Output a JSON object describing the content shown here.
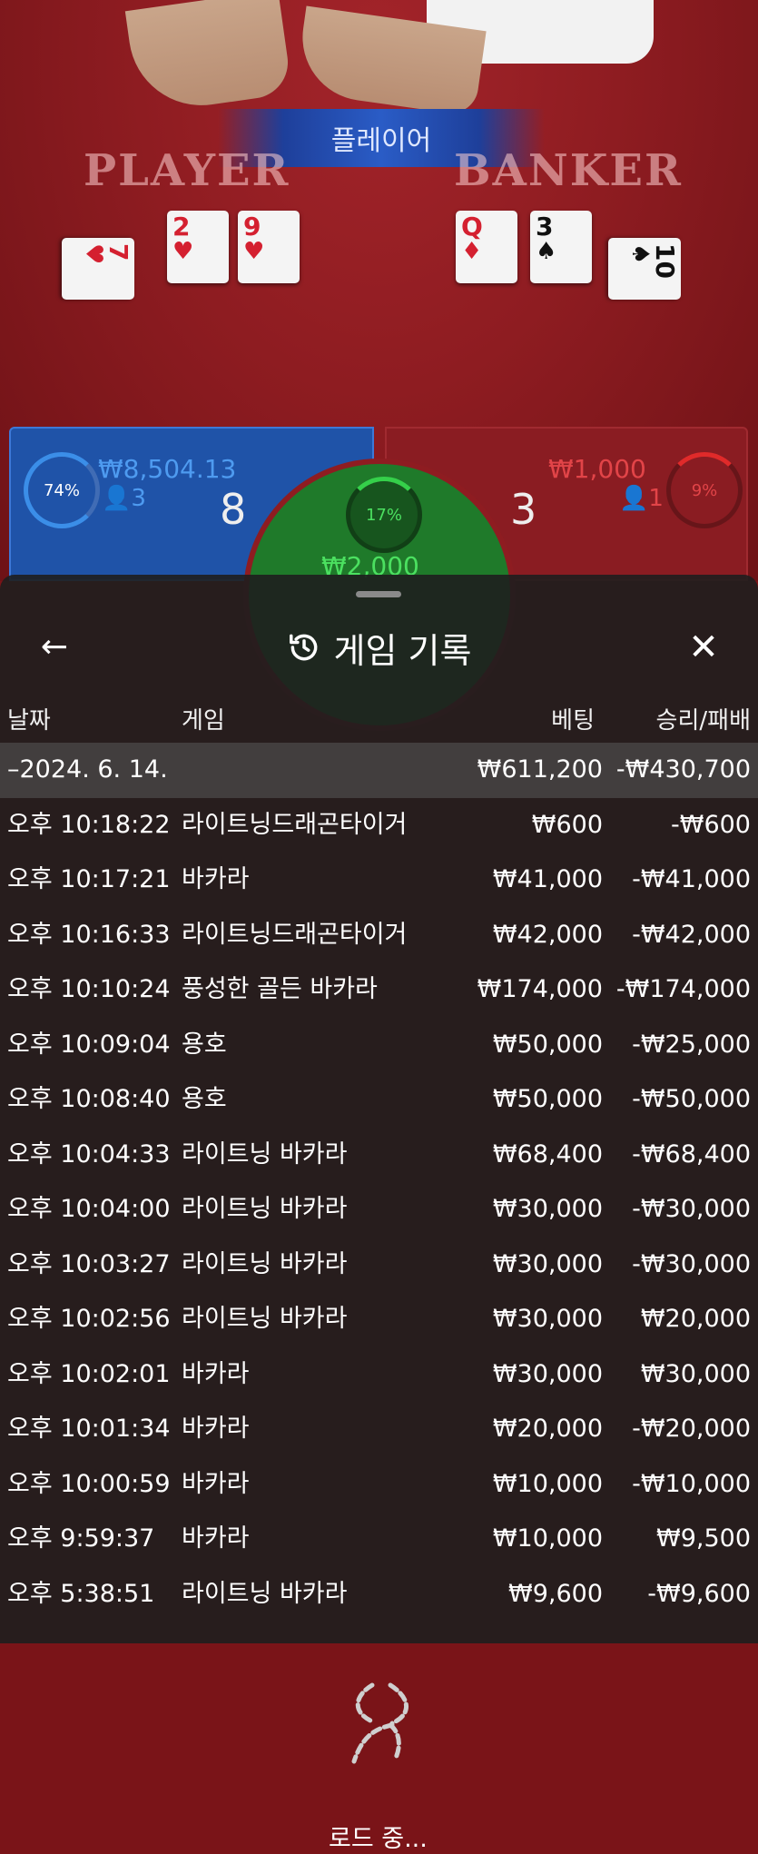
{
  "table": {
    "result_banner": "플레이어",
    "player_title": "PLAYER",
    "banker_title": "BANKER",
    "player_cards": [
      {
        "rank": "7",
        "suit": "♥",
        "color": "red"
      },
      {
        "rank": "2",
        "suit": "♥",
        "color": "red"
      },
      {
        "rank": "9",
        "suit": "♥",
        "color": "red"
      }
    ],
    "banker_cards": [
      {
        "rank": "Q",
        "suit": "♦",
        "color": "red"
      },
      {
        "rank": "3",
        "suit": "♠",
        "color": "black"
      },
      {
        "rank": "10",
        "suit": "♠",
        "color": "black"
      }
    ],
    "player_panel": {
      "percent": "74%",
      "amount": "₩8,504.13",
      "players": "3",
      "score": "8"
    },
    "tie_panel": {
      "percent": "17%",
      "amount": "₩2,000"
    },
    "banker_panel": {
      "percent": "9%",
      "amount": "₩1,000",
      "players": "1",
      "score": "3"
    }
  },
  "sheet": {
    "title": "게임 기록",
    "columns": {
      "date": "날짜",
      "game": "게임",
      "bet": "베팅",
      "result": "승리/패배"
    },
    "summary": {
      "date": "–2024. 6. 14.",
      "bet": "₩611,200",
      "result": "-₩430,700"
    },
    "rows": [
      {
        "time": "오후 10:18:22",
        "game": "라이트닝드래곤타이거",
        "bet": "₩600",
        "result": "-₩600"
      },
      {
        "time": "오후 10:17:21",
        "game": "바카라",
        "bet": "₩41,000",
        "result": "-₩41,000"
      },
      {
        "time": "오후 10:16:33",
        "game": "라이트닝드래곤타이거",
        "bet": "₩42,000",
        "result": "-₩42,000"
      },
      {
        "time": "오후 10:10:24",
        "game": "풍성한 골든 바카라",
        "bet": "₩174,000",
        "result": "-₩174,000"
      },
      {
        "time": "오후 10:09:04",
        "game": "용호",
        "bet": "₩50,000",
        "result": "-₩25,000"
      },
      {
        "time": "오후 10:08:40",
        "game": "용호",
        "bet": "₩50,000",
        "result": "-₩50,000"
      },
      {
        "time": "오후 10:04:33",
        "game": "라이트닝 바카라",
        "bet": "₩68,400",
        "result": "-₩68,400"
      },
      {
        "time": "오후 10:04:00",
        "game": "라이트닝 바카라",
        "bet": "₩30,000",
        "result": "-₩30,000"
      },
      {
        "time": "오후 10:03:27",
        "game": "라이트닝 바카라",
        "bet": "₩30,000",
        "result": "-₩30,000"
      },
      {
        "time": "오후 10:02:56",
        "game": "라이트닝 바카라",
        "bet": "₩30,000",
        "result": "₩20,000"
      },
      {
        "time": "오후 10:02:01",
        "game": "바카라",
        "bet": "₩30,000",
        "result": "₩30,000"
      },
      {
        "time": "오후 10:01:34",
        "game": "바카라",
        "bet": "₩20,000",
        "result": "-₩20,000"
      },
      {
        "time": "오후 10:00:59",
        "game": "바카라",
        "bet": "₩10,000",
        "result": "-₩10,000"
      },
      {
        "time": "오후 9:59:37",
        "game": "바카라",
        "bet": "₩10,000",
        "result": "₩9,500"
      },
      {
        "time": "오후 5:38:51",
        "game": "라이트닝 바카라",
        "bet": "₩9,600",
        "result": "-₩9,600"
      }
    ],
    "loading_text": "로드 중..."
  },
  "colors": {
    "player_blue": "#1f53a8",
    "banker_red": "#8a1c22",
    "tie_green": "#1f7a2a",
    "sheet_bg": "#1e1e1e"
  }
}
